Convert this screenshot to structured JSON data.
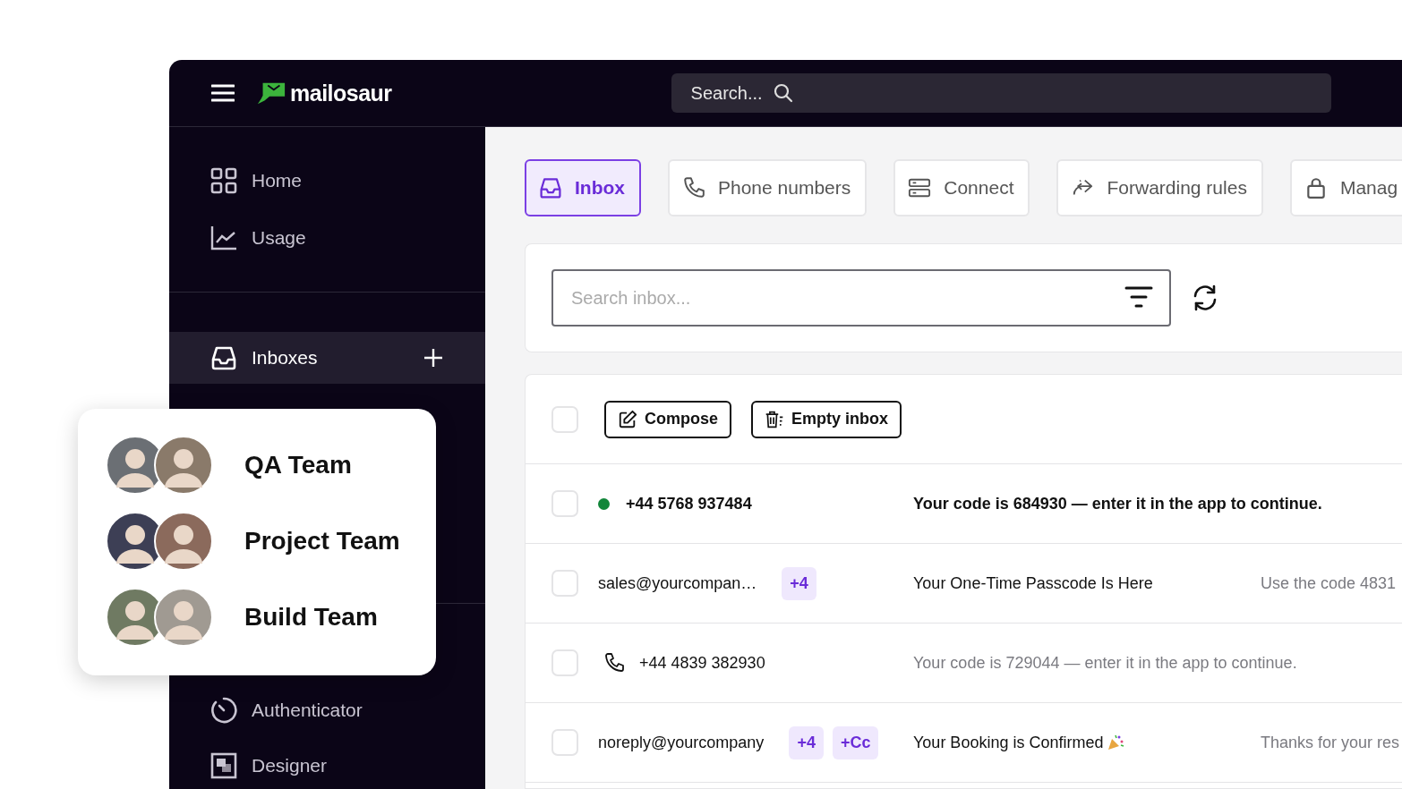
{
  "topbar": {
    "logo": "mailosaur",
    "search": {
      "placeholder": "Search..."
    }
  },
  "sidebar": {
    "sections": [
      {
        "items": [
          {
            "label": "Home",
            "selected": false
          },
          {
            "label": "Usage",
            "selected": false
          }
        ]
      },
      {
        "items": [
          {
            "label": "Inboxes",
            "selected": true,
            "add": true
          }
        ]
      },
      {
        "items": [
          {
            "label": "Authenticator",
            "selected": false
          },
          {
            "label": "Designer",
            "selected": false
          }
        ]
      }
    ]
  },
  "teams": [
    {
      "name": "QA Team"
    },
    {
      "name": "Project Team"
    },
    {
      "name": "Build Team"
    }
  ],
  "tabs": [
    {
      "label": "Inbox",
      "selected": true
    },
    {
      "label": "Phone numbers",
      "selected": false
    },
    {
      "label": "Connect",
      "selected": false
    },
    {
      "label": "Forwarding rules",
      "selected": false
    },
    {
      "label": "Manag",
      "selected": false
    }
  ],
  "inbox_search": {
    "placeholder": "Search inbox..."
  },
  "toolbar": {
    "select_all": {
      "checked": false
    },
    "buttons": [
      "Compose",
      "Empty inbox"
    ]
  },
  "messages": [
    {
      "kind": "sms",
      "unread": true,
      "checked": false,
      "from": "+44 5768 937484",
      "text": "Your code is 684930 — enter it in the app to continue."
    },
    {
      "kind": "email",
      "unread": false,
      "checked": false,
      "from": "sales@yourcompan…",
      "badges": [
        "+4"
      ],
      "subject": "Your One-Time Passcode Is Here",
      "preview": "Use the code 4831"
    },
    {
      "kind": "sms",
      "unread": false,
      "checked": false,
      "from": "+44 4839 382930",
      "text": "Your code is 729044 — enter it in the app to continue."
    },
    {
      "kind": "email",
      "unread": false,
      "checked": false,
      "from": "noreply@yourcompany",
      "badges": [
        "+4",
        "+Cc"
      ],
      "subject": "Your Booking is Confirmed",
      "celebration": true,
      "preview": "Thanks for your res"
    }
  ]
}
